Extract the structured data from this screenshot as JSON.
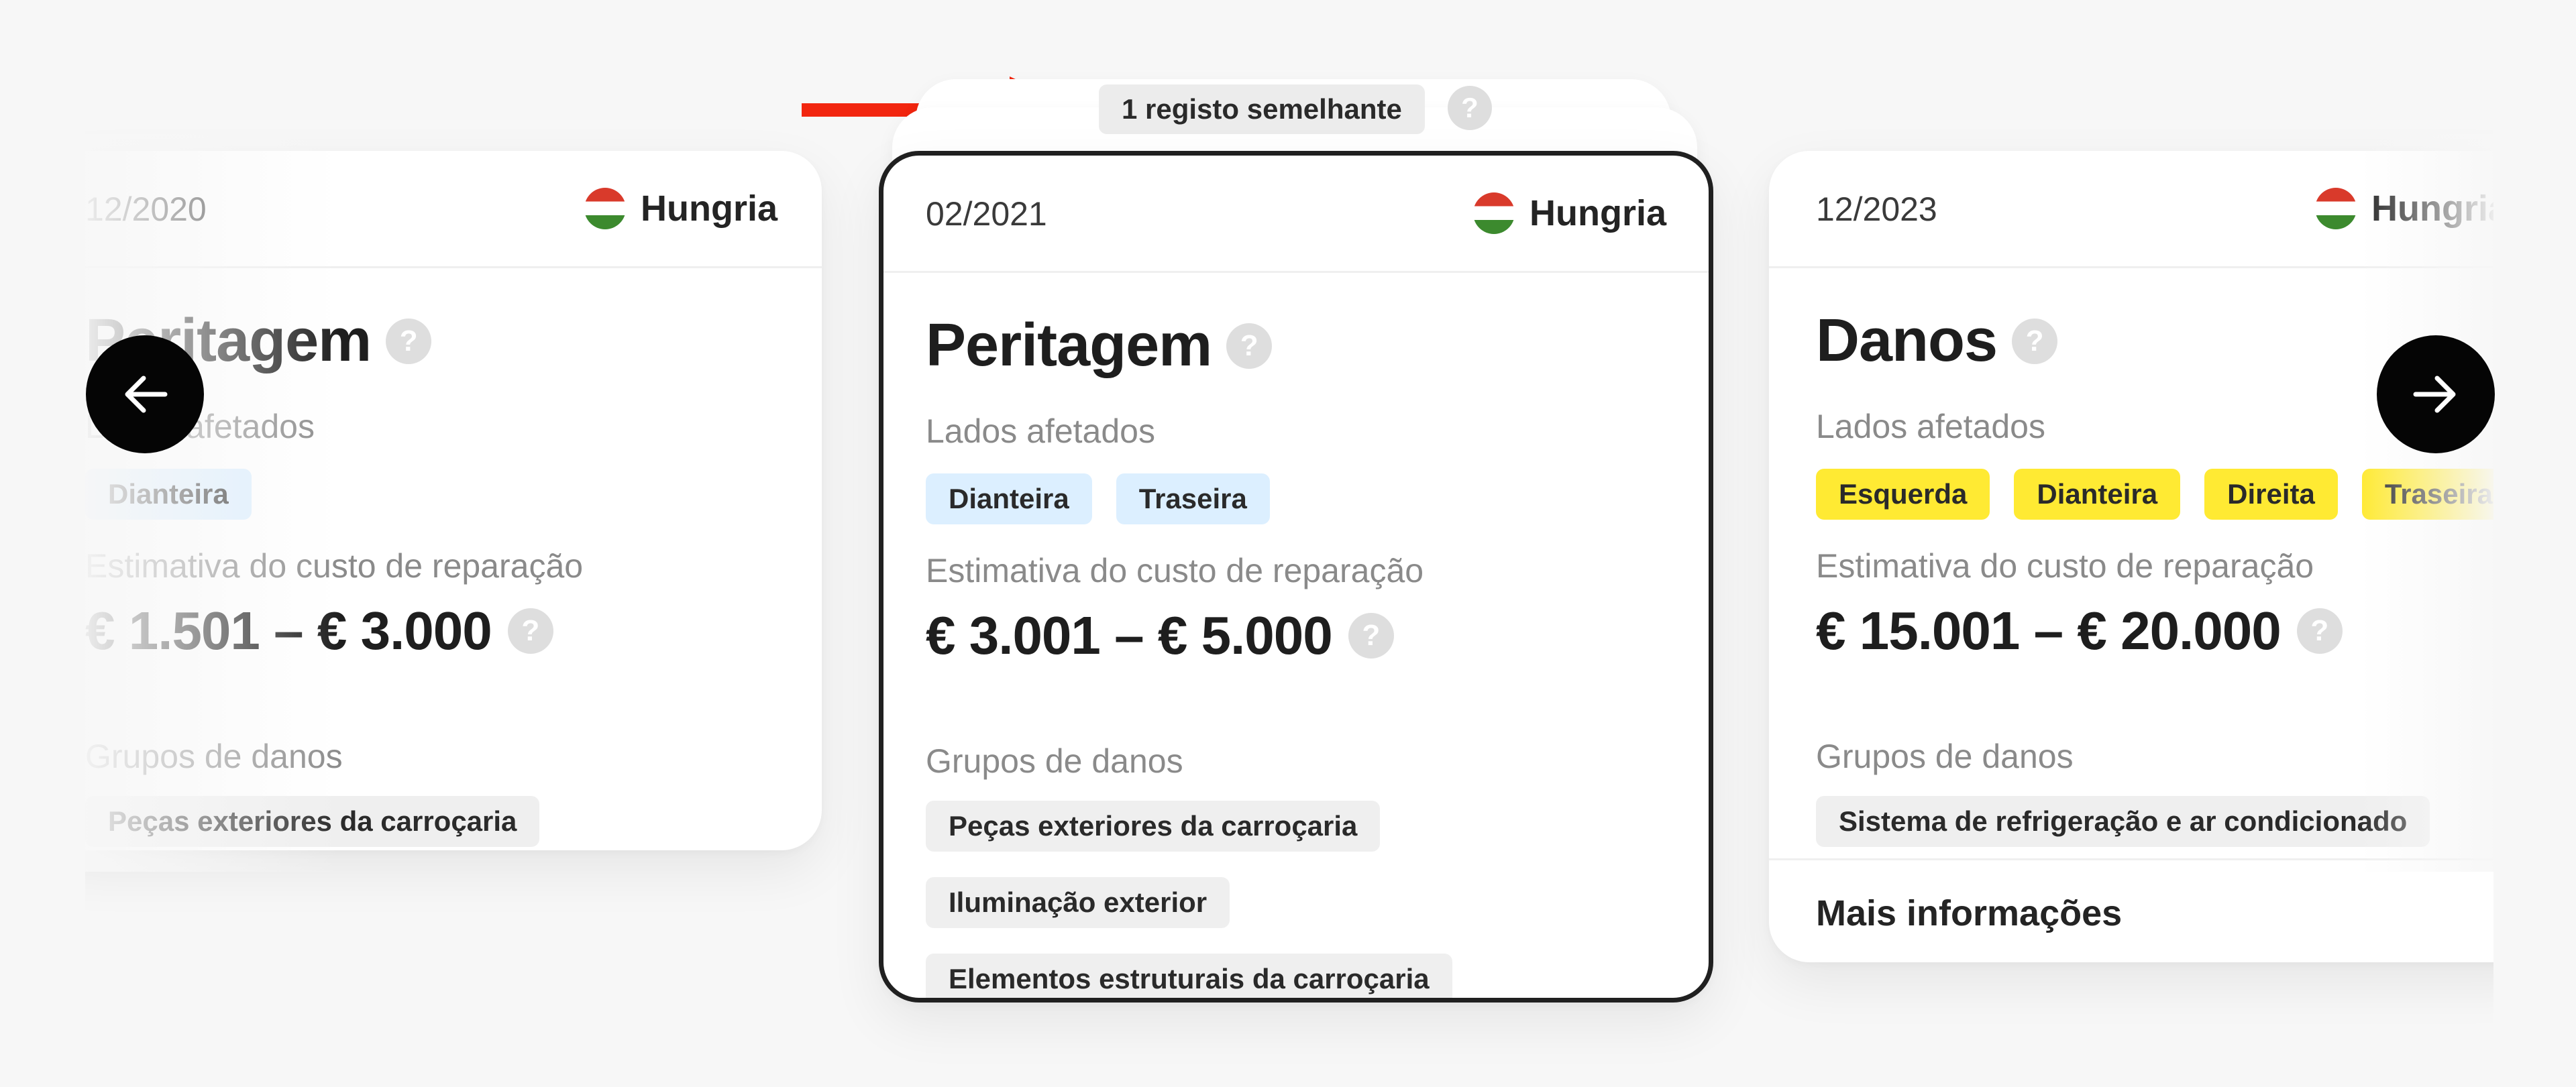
{
  "similar_records": {
    "label": "1 registo semelhante"
  },
  "cards": [
    {
      "date": "12/2020",
      "country": "Hungria",
      "title": "Peritagem",
      "sides_label": "Lados afetados",
      "sides": [
        "Dianteira"
      ],
      "cost_label": "Estimativa do custo de reparação",
      "cost": "€ 1.501 – € 3.000",
      "groups_label": "Grupos de danos",
      "groups": [
        "Peças exteriores da carroçaria"
      ]
    },
    {
      "date": "02/2021",
      "country": "Hungria",
      "title": "Peritagem",
      "sides_label": "Lados afetados",
      "sides": [
        "Dianteira",
        "Traseira"
      ],
      "cost_label": "Estimativa do custo de reparação",
      "cost": "€ 3.001 – € 5.000",
      "groups_label": "Grupos de danos",
      "groups": [
        "Peças exteriores da carroçaria",
        "Iluminação exterior",
        "Elementos estruturais da carroçaria"
      ]
    },
    {
      "date": "12/2023",
      "country": "Hungria",
      "title": "Danos",
      "sides_label": "Lados afetados",
      "sides": [
        "Esquerda",
        "Dianteira",
        "Direita",
        "Traseira"
      ],
      "cost_label": "Estimativa do custo de reparação",
      "cost": "€ 15.001 – € 20.000",
      "groups_label": "Grupos de danos",
      "groups": [
        "Sistema de refrigeração e ar condicionado"
      ],
      "more_label": "Mais informações"
    }
  ],
  "help_glyph": "?",
  "icons": {
    "prev": "arrow-left-icon",
    "next": "arrow-right-icon",
    "annotation": "red-arrow-icon"
  },
  "colors": {
    "background": "#f7f7f7",
    "chip_blue": "#dcefff",
    "chip_yellow": "#ffea33",
    "chip_gray": "#efefef",
    "annotation_arrow": "#f2260f",
    "nav_button": "#050505"
  }
}
